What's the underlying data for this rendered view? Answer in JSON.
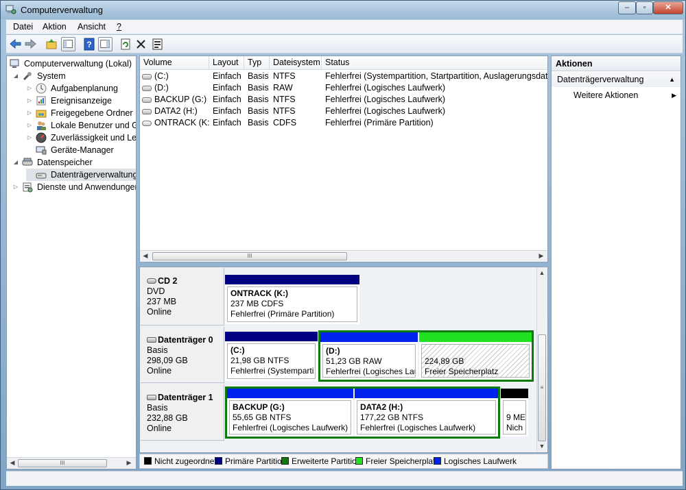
{
  "window": {
    "title": "Computerverwaltung",
    "min_icon": "minimize-glyph",
    "max_icon": "maximize-glyph",
    "close_label": "✕"
  },
  "menu": [
    {
      "label": "Datei"
    },
    {
      "label": "Aktion"
    },
    {
      "label": "Ansicht"
    },
    {
      "label": "?"
    }
  ],
  "toolbar": [
    "back-arrow-icon",
    "forward-arrow-icon",
    "up-folder-icon",
    "show-hide-tree-icon",
    "help-icon",
    "show-hide-action-pane-icon",
    "refresh-icon",
    "delete-icon",
    "properties-icon"
  ],
  "tree": {
    "root": "Computerverwaltung (Lokal)",
    "system": "System",
    "items_system": [
      "Aufgabenplanung",
      "Ereignisanzeige",
      "Freigegebene Ordner",
      "Lokale Benutzer und Gr",
      "Zuverlässigkeit und Leis",
      "Geräte-Manager"
    ],
    "storage": "Datenspeicher",
    "storage_child": "Datenträgerverwaltung",
    "services": "Dienste und Anwendungen"
  },
  "volume_list": {
    "headers": [
      "Volume",
      "Layout",
      "Typ",
      "Dateisystem",
      "Status"
    ],
    "rows": [
      {
        "volume": "(C:)",
        "layout": "Einfach",
        "typ": "Basis",
        "fs": "NTFS",
        "status": "Fehlerfrei (Systempartition, Startpartition, Auslagerungsdatei,"
      },
      {
        "volume": "(D:)",
        "layout": "Einfach",
        "typ": "Basis",
        "fs": "RAW",
        "status": "Fehlerfrei (Logisches Laufwerk)"
      },
      {
        "volume": "BACKUP (G:)",
        "layout": "Einfach",
        "typ": "Basis",
        "fs": "NTFS",
        "status": "Fehlerfrei (Logisches Laufwerk)"
      },
      {
        "volume": "DATA2 (H:)",
        "layout": "Einfach",
        "typ": "Basis",
        "fs": "NTFS",
        "status": "Fehlerfrei (Logisches Laufwerk)"
      },
      {
        "volume": "ONTRACK (K:)",
        "layout": "Einfach",
        "typ": "Basis",
        "fs": "CDFS",
        "status": "Fehlerfrei (Primäre Partition)"
      }
    ]
  },
  "disks": {
    "cd2": {
      "name": "CD 2",
      "type": "DVD",
      "size": "237 MB",
      "state": "Online",
      "part": {
        "title": "ONTRACK  (K:)",
        "line1": "237 MB CDFS",
        "line2": "Fehlerfrei (Primäre Partition)"
      }
    },
    "disk0": {
      "name": "Datenträger 0",
      "type": "Basis",
      "size": "298,09 GB",
      "state": "Online",
      "c": {
        "title": "(C:)",
        "line1": "21,98 GB NTFS",
        "line2": "Fehlerfrei (Systemparti"
      },
      "d": {
        "title": "(D:)",
        "line1": "51,23 GB RAW",
        "line2": "Fehlerfrei (Logisches Lau"
      },
      "free": {
        "line1": "224,89 GB",
        "line2": "Freier Speicherplatz"
      }
    },
    "disk1": {
      "name": "Datenträger 1",
      "type": "Basis",
      "size": "232,88 GB",
      "state": "Online",
      "g": {
        "title": "BACKUP  (G:)",
        "line1": "55,65 GB NTFS",
        "line2": "Fehlerfrei (Logisches Laufwerk)"
      },
      "h": {
        "title": "DATA2  (H:)",
        "line1": "177,22 GB NTFS",
        "line2": "Fehlerfrei (Logisches Laufwerk)"
      },
      "u": {
        "line1": "9 ME",
        "line2": "Nich"
      }
    }
  },
  "legend": [
    {
      "label": "Nicht zugeordnet",
      "color": "#000000"
    },
    {
      "label": "Primäre Partition",
      "color": "#000080"
    },
    {
      "label": "Erweiterte Partition",
      "color": "#0b7a0b"
    },
    {
      "label": "Freier Speicherplatz",
      "color": "#22e022"
    },
    {
      "label": "Logisches Laufwerk",
      "color": "#0022ee"
    }
  ],
  "actions": {
    "title": "Aktionen",
    "section": "Datenträgerverwaltung",
    "more": "Weitere Aktionen"
  },
  "scroll_glyph": "III"
}
